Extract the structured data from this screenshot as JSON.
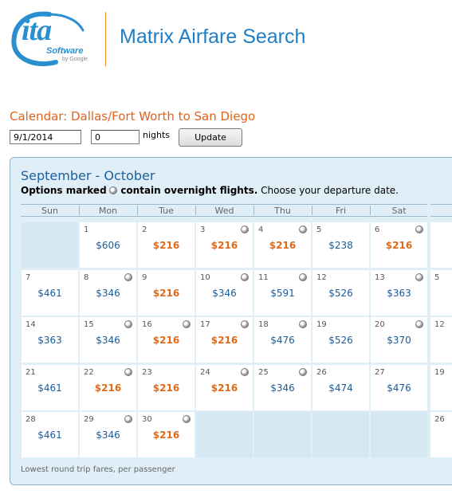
{
  "logo": {
    "main": "ita",
    "sub": "Software",
    "by": "by Google"
  },
  "app_title": "Matrix Airfare Search",
  "calendar_title": "Calendar: Dallas/Fort Worth to San Diego",
  "form": {
    "date": "9/1/2014",
    "nights": "0",
    "nights_label": "nights",
    "update_label": "Update"
  },
  "month_title": "September - October",
  "note": {
    "prefix": "Options marked",
    "suffix": "contain overnight flights.",
    "tail": "Choose your departure date."
  },
  "weekdays": [
    "Sun",
    "Mon",
    "Tue",
    "Wed",
    "Thu",
    "Fri",
    "Sat"
  ],
  "days": [
    {
      "day": "",
      "price": "",
      "low": false,
      "overnight": false
    },
    {
      "day": "1",
      "price": "$606",
      "low": false,
      "overnight": false
    },
    {
      "day": "2",
      "price": "$216",
      "low": true,
      "overnight": false
    },
    {
      "day": "3",
      "price": "$216",
      "low": true,
      "overnight": true
    },
    {
      "day": "4",
      "price": "$216",
      "low": true,
      "overnight": true
    },
    {
      "day": "5",
      "price": "$238",
      "low": false,
      "overnight": false
    },
    {
      "day": "6",
      "price": "$216",
      "low": true,
      "overnight": true
    },
    {
      "day": "7",
      "price": "$461",
      "low": false,
      "overnight": false
    },
    {
      "day": "8",
      "price": "$346",
      "low": false,
      "overnight": true
    },
    {
      "day": "9",
      "price": "$216",
      "low": true,
      "overnight": false
    },
    {
      "day": "10",
      "price": "$346",
      "low": false,
      "overnight": true
    },
    {
      "day": "11",
      "price": "$591",
      "low": false,
      "overnight": true
    },
    {
      "day": "12",
      "price": "$526",
      "low": false,
      "overnight": false
    },
    {
      "day": "13",
      "price": "$363",
      "low": false,
      "overnight": true
    },
    {
      "day": "14",
      "price": "$363",
      "low": false,
      "overnight": false
    },
    {
      "day": "15",
      "price": "$346",
      "low": false,
      "overnight": true
    },
    {
      "day": "16",
      "price": "$216",
      "low": true,
      "overnight": true
    },
    {
      "day": "17",
      "price": "$216",
      "low": true,
      "overnight": true
    },
    {
      "day": "18",
      "price": "$476",
      "low": false,
      "overnight": true
    },
    {
      "day": "19",
      "price": "$526",
      "low": false,
      "overnight": false
    },
    {
      "day": "20",
      "price": "$370",
      "low": false,
      "overnight": true
    },
    {
      "day": "21",
      "price": "$461",
      "low": false,
      "overnight": false
    },
    {
      "day": "22",
      "price": "$216",
      "low": true,
      "overnight": true
    },
    {
      "day": "23",
      "price": "$216",
      "low": true,
      "overnight": false
    },
    {
      "day": "24",
      "price": "$216",
      "low": true,
      "overnight": true
    },
    {
      "day": "25",
      "price": "$346",
      "low": false,
      "overnight": true
    },
    {
      "day": "26",
      "price": "$474",
      "low": false,
      "overnight": false
    },
    {
      "day": "27",
      "price": "$476",
      "low": false,
      "overnight": false
    },
    {
      "day": "28",
      "price": "$461",
      "low": false,
      "overnight": false
    },
    {
      "day": "29",
      "price": "$346",
      "low": false,
      "overnight": true
    },
    {
      "day": "30",
      "price": "$216",
      "low": true,
      "overnight": true
    },
    {
      "day": "",
      "price": "",
      "low": false,
      "overnight": false
    },
    {
      "day": "",
      "price": "",
      "low": false,
      "overnight": false
    },
    {
      "day": "",
      "price": "",
      "low": false,
      "overnight": false
    },
    {
      "day": "",
      "price": "",
      "low": false,
      "overnight": false
    }
  ],
  "next_month_days": [
    "5",
    "12",
    "19",
    "26"
  ],
  "footer": "Lowest round trip fares, per passenger"
}
